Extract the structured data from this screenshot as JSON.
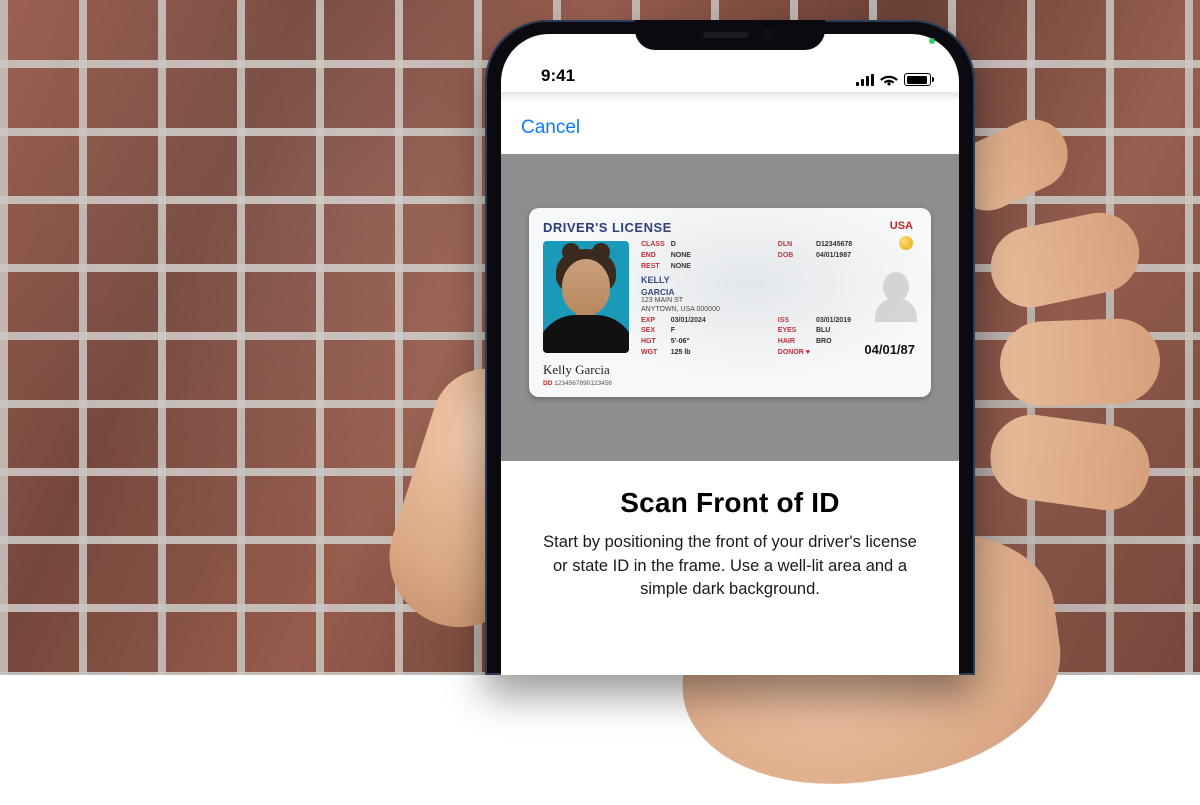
{
  "statusbar": {
    "time": "9:41"
  },
  "sheet": {
    "cancel_label": "Cancel",
    "title": "Scan Front of ID",
    "instructions": "Start by positioning the front of your driver's license or state ID in the frame. Use a well-lit area and a simple dark background."
  },
  "id_card": {
    "header": "DRIVER'S LICENSE",
    "country": "USA",
    "last_name": "KELLY",
    "first_name": "GARCIA",
    "address_line1": "123 MAIN ST",
    "address_line2": "ANYTOWN, USA 000000",
    "class_label": "CLASS",
    "class_value": "D",
    "dln_label": "DLN",
    "dln_value": "D12345678",
    "end_label": "END",
    "end_value": "NONE",
    "dob_label": "DOB",
    "dob_value": "04/01/1987",
    "rest_label": "REST",
    "rest_value": "NONE",
    "exp_label": "EXP",
    "exp_value": "03/01/2024",
    "iss_label": "ISS",
    "iss_value": "03/01/2019",
    "sex_label": "SEX",
    "sex_value": "F",
    "eyes_label": "EYES",
    "eyes_value": "BLU",
    "hgt_label": "HGT",
    "hgt_value": "5'-06\"",
    "hair_label": "HAIR",
    "hair_value": "BRO",
    "wgt_label": "WGT",
    "wgt_value": "125 lb",
    "donor_label": "DONOR",
    "big_dob": "04/01/87",
    "signature": "Kelly Garcia",
    "dd_label": "DD",
    "dd_value": "1234567890123456"
  }
}
